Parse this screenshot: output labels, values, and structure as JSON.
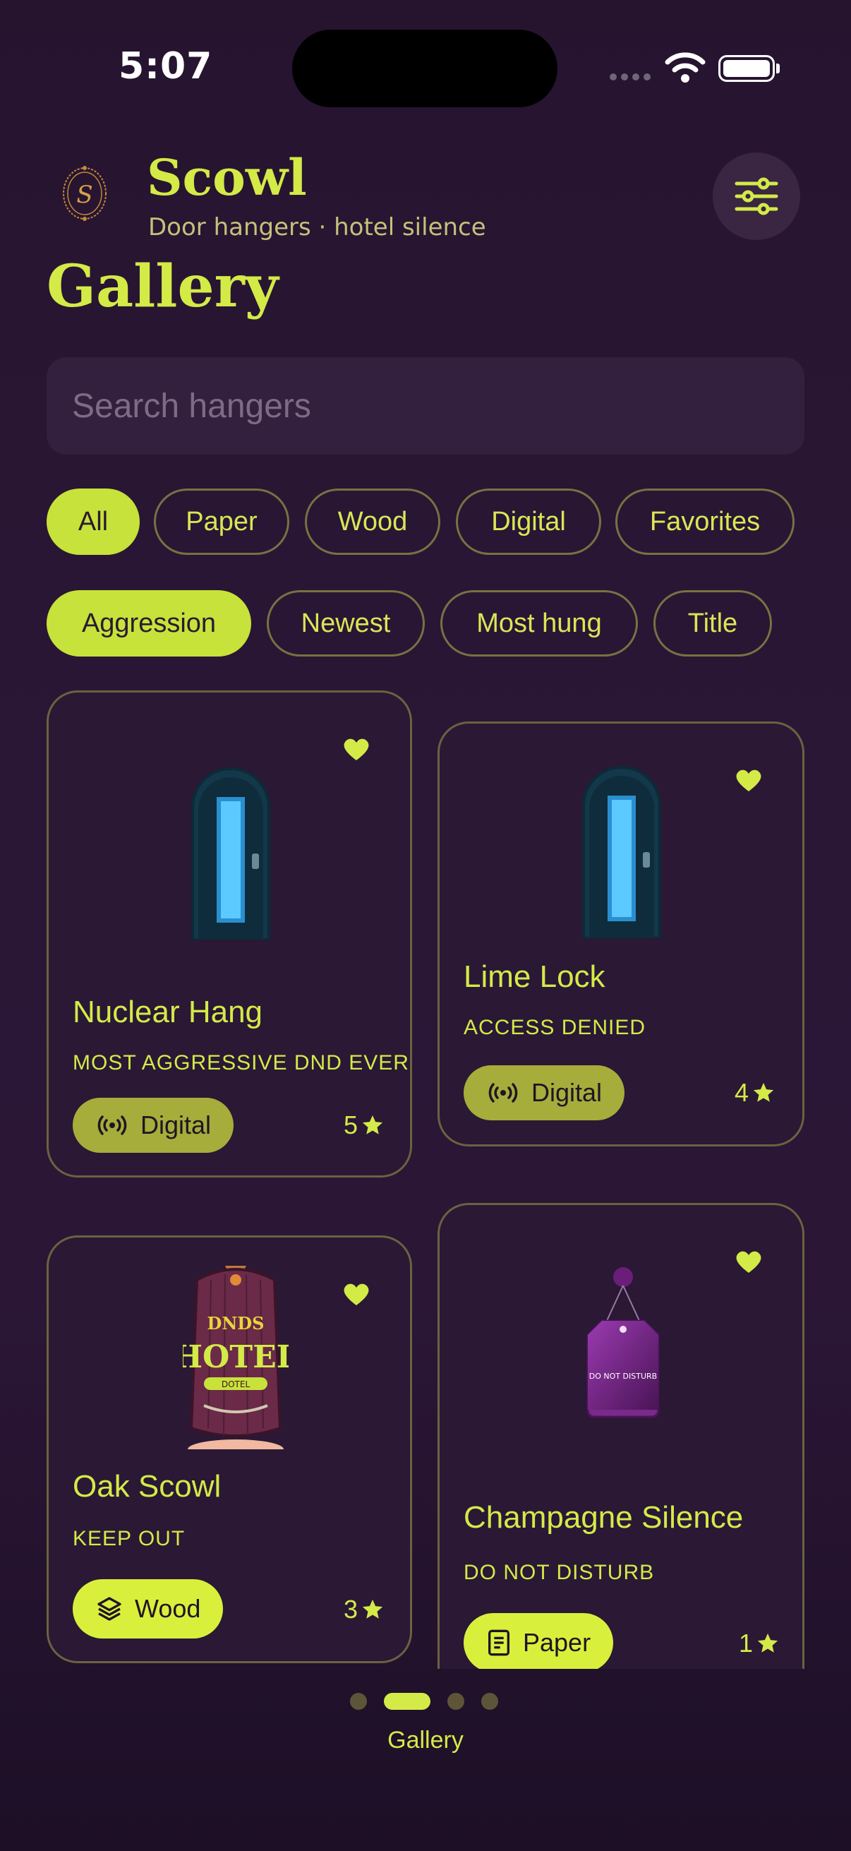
{
  "status_bar": {
    "time": "5:07"
  },
  "header": {
    "app_title": "Scowl",
    "app_subtitle": "Door hangers · hotel silence",
    "page_title": "Gallery"
  },
  "search": {
    "placeholder": "Search hangers",
    "value": ""
  },
  "filters": [
    "All",
    "Paper",
    "Wood",
    "Digital",
    "Favorites"
  ],
  "sort_options": [
    "Aggression",
    "Newest",
    "Most hung",
    "Title"
  ],
  "active_filter": "All",
  "active_sort": "Aggression",
  "cards": [
    {
      "title": "Nuclear Hang",
      "tagline": "MOST AGGRESSIVE DND EVER",
      "material": "Digital",
      "rating": "5",
      "favorite": true
    },
    {
      "title": "Lime Lock",
      "tagline": "ACCESS DENIED",
      "material": "Digital",
      "rating": "4",
      "favorite": true
    },
    {
      "title": "Oak Scowl",
      "tagline": "KEEP OUT",
      "material": "Wood",
      "rating": "3",
      "favorite": true
    },
    {
      "title": "Champagne Silence",
      "tagline": "DO NOT DISTURB",
      "material": "Paper",
      "rating": "1",
      "favorite": true
    }
  ],
  "artwork_text": {
    "wood_sign_top": "DNDS",
    "wood_sign_main": "HOTEL",
    "wood_sign_plate": "DOTEL",
    "paper_tag": "DO NOT DISTURB"
  },
  "pager": {
    "label": "Gallery",
    "pages": 4,
    "current": 2
  },
  "colors": {
    "accent": "#d4ea47",
    "background": "#2a1736",
    "card_border": "#6b6240"
  },
  "icons": {
    "filter": "sliders-icon",
    "favorite": "heart-icon",
    "digital": "broadcast-icon",
    "wood": "layers-icon",
    "paper": "document-icon",
    "rating": "star-icon"
  }
}
